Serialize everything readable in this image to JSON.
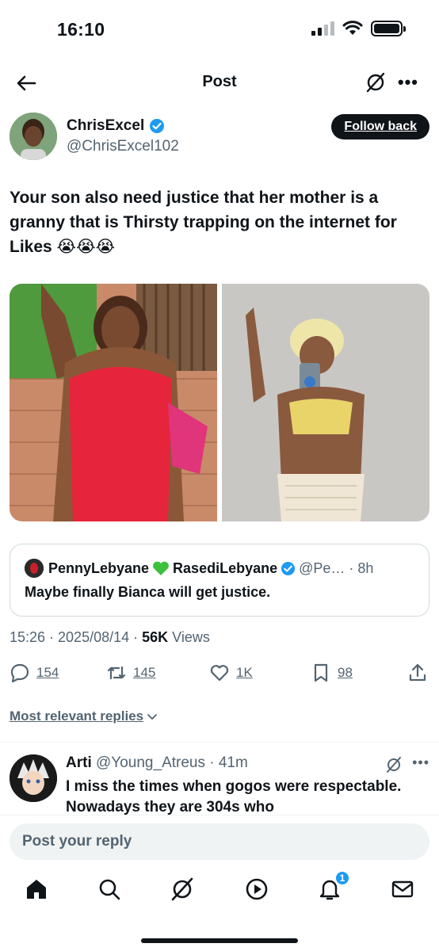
{
  "status_bar": {
    "time": "16:10"
  },
  "header": {
    "title": "Post"
  },
  "author": {
    "name": "ChrisExcel",
    "handle": "@ChrisExcel102",
    "follow_label": "Follow back"
  },
  "post": {
    "text": "Your son also need justice that her mother is a granny that is Thirsty trapping on the internet for Likes 😭😭😭",
    "media": [
      {
        "alt": "woman in red swimsuit on patio"
      },
      {
        "alt": "woman with blonde hair taking mirror selfie"
      }
    ]
  },
  "quote": {
    "name": "PennyLebyane",
    "name2": "RasediLebyane",
    "handle_time": "@Pe… · 8h",
    "text": "Maybe finally Bianca will get justice."
  },
  "meta": {
    "timestamp": "15:26 · 2025/08/14 · ",
    "views_count": "56K",
    "views_label": " Views"
  },
  "actions": {
    "replies": "154",
    "reposts": "145",
    "likes": "1K",
    "bookmarks": "98"
  },
  "sort": {
    "label": "Most relevant replies"
  },
  "reply": {
    "name": "Arti",
    "handle_time": "@Young_Atreus · 41m",
    "text": "I miss the times when gogos were respectable. Nowadays they are 304s who"
  },
  "reply_input": {
    "placeholder": "Post your reply"
  },
  "nav": {
    "notification_count": "1"
  },
  "colors": {
    "accent": "#1d9bf0",
    "text": "#0f1419",
    "muted": "#536471"
  }
}
